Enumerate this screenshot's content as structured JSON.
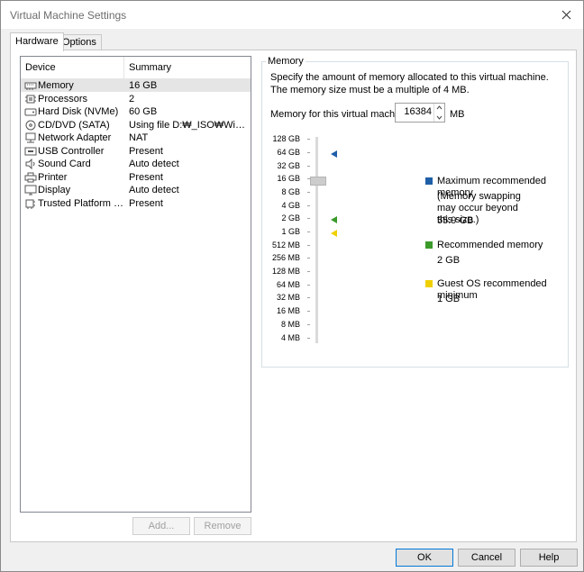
{
  "window": {
    "title": "Virtual Machine Settings"
  },
  "tabs": [
    {
      "label": "Hardware",
      "active": true
    },
    {
      "label": "Options",
      "active": false
    }
  ],
  "device_list": {
    "columns": [
      "Device",
      "Summary"
    ],
    "rows": [
      {
        "icon": "memory-icon",
        "device": "Memory",
        "summary": "16 GB",
        "selected": true
      },
      {
        "icon": "processor-icon",
        "device": "Processors",
        "summary": "2"
      },
      {
        "icon": "hard-disk-icon",
        "device": "Hard Disk (NVMe)",
        "summary": "60 GB"
      },
      {
        "icon": "cd-dvd-icon",
        "device": "CD/DVD (SATA)",
        "summary": "Using file D:₩_ISO₩Windo..."
      },
      {
        "icon": "network-adapter-icon",
        "device": "Network Adapter",
        "summary": "NAT"
      },
      {
        "icon": "usb-icon",
        "device": "USB Controller",
        "summary": "Present"
      },
      {
        "icon": "sound-card-icon",
        "device": "Sound Card",
        "summary": "Auto detect"
      },
      {
        "icon": "printer-icon",
        "device": "Printer",
        "summary": "Present"
      },
      {
        "icon": "display-icon",
        "device": "Display",
        "summary": "Auto detect"
      },
      {
        "icon": "tpm-icon",
        "device": "Trusted Platform Mo...",
        "summary": "Present"
      }
    ],
    "add_label": "Add...",
    "remove_label": "Remove"
  },
  "memory": {
    "group_label": "Memory",
    "description": "Specify the amount of memory allocated to this virtual machine. The memory size must be a multiple of 4 MB.",
    "field_label": "Memory for this virtual machine:",
    "value": "16384",
    "unit": "MB",
    "scale": [
      "128 GB",
      "64 GB",
      "32 GB",
      "16 GB",
      "8 GB",
      "4 GB",
      "2 GB",
      "1 GB",
      "512 MB",
      "256 MB",
      "128 MB",
      "64 MB",
      "32 MB",
      "16 MB",
      "8 MB",
      "4 MB"
    ],
    "slider_value": "16 GB",
    "legend": {
      "max": {
        "label": "Maximum recommended memory",
        "note": "(Memory swapping may occur beyond this size.)",
        "value": "55.9 GB",
        "color": "#1f5fa8"
      },
      "recommended": {
        "label": "Recommended memory",
        "value": "2 GB",
        "color": "#3a9a2a"
      },
      "guest": {
        "label": "Guest OS recommended minimum",
        "value": "1 GB",
        "color": "#f0d000"
      }
    }
  },
  "footer": {
    "ok": "OK",
    "cancel": "Cancel",
    "help": "Help"
  }
}
